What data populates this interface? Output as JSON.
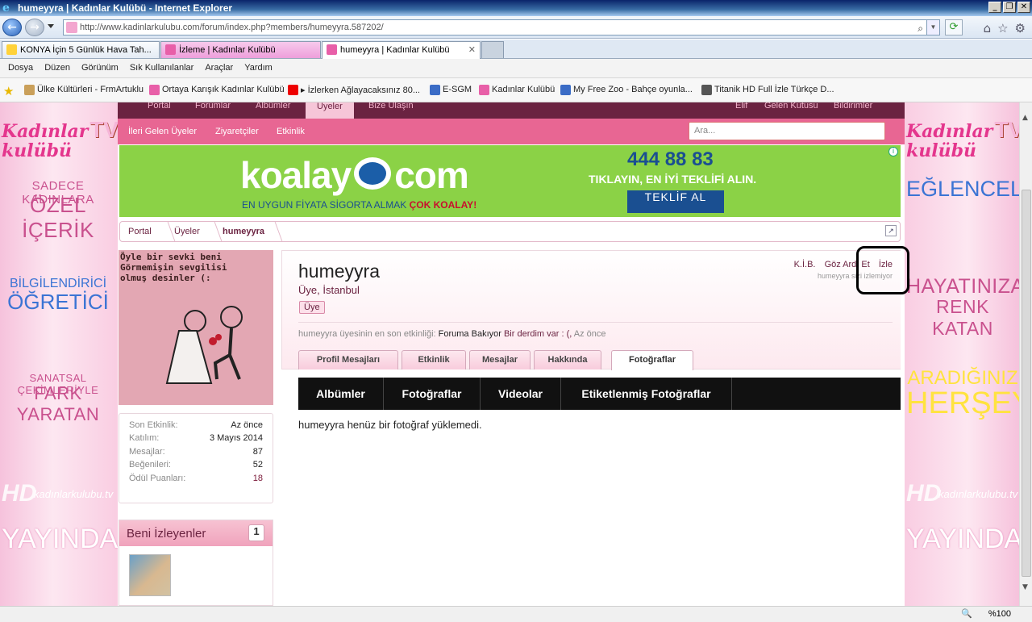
{
  "window": {
    "title": "humeyyra | Kadınlar Kulübü - Internet Explorer"
  },
  "address": {
    "url": "http://www.kadinlarkulubu.com/forum/index.php?members/humeyyra.587202/"
  },
  "tabs": [
    {
      "label": "KONYA İçin 5 Günlük Hava Tah..."
    },
    {
      "label": "İzleme | Kadınlar Kulübü"
    },
    {
      "label": "humeyyra | Kadınlar Kulübü"
    }
  ],
  "menu": [
    "Dosya",
    "Düzen",
    "Görünüm",
    "Sık Kullanılanlar",
    "Araçlar",
    "Yardım"
  ],
  "favorites": [
    "Ülke Kültürleri - FrmArtuklu",
    "Ortaya Karışık  Kadınlar Kulübü",
    "▸ İzlerken Ağlayacaksınız 80...",
    "E-SGM",
    "Kadınlar Kulübü",
    "My Free Zoo - Bahçe oyunla...",
    "Titanik HD Full İzle Türkçe D..."
  ],
  "left_ad": {
    "logo_line1": "Kadınlar",
    "logo_line2": "kulübü",
    "logo_tv": "TV",
    "l1": "SADECE KADINLARA",
    "l2": "ÖZEL İÇERİK",
    "l3": "BİLGİLENDİRİCİ",
    "l4": "ÖĞRETİCİ",
    "l5": "SANATSAL ÇEKİMLERİYLE",
    "l6": "FARK YARATAN",
    "hd": "HD",
    "site": "kadınlarkulubu.tv",
    "yayinda": "YAYINDA"
  },
  "right_ad": {
    "logo_line1": "Kadınlar",
    "logo_line2": "kulübü",
    "logo_tv": "TV",
    "l1": "EĞLENCELİ",
    "l2": "HAYATINIZA",
    "l3": "RENK KATAN",
    "l4": "ARADIĞINIZ",
    "l5": "HERŞEY",
    "hd": "HD",
    "site": "kadınlarkulubu.tv",
    "yayinda": "YAYINDA"
  },
  "site_nav": {
    "portal": "Portal",
    "forumlar": "Forumlar",
    "albumler": "Albümler",
    "uyeler": "Üyeler",
    "bize_ulasin": "Bize Ulaşın",
    "user": "Elif",
    "inbox": "Gelen Kutusu",
    "alerts": "Bildirimler"
  },
  "sub_nav": {
    "notable": "İleri Gelen Üyeler",
    "visitors": "Ziyaretçiler",
    "activity": "Etkinlik",
    "search_placeholder": "Ara..."
  },
  "banner": {
    "brand_left": "koalay",
    "brand_right": "com",
    "tagline": "EN UYGUN FİYATA SİGORTA ALMAK",
    "tagline_bold": "ÇOK KOALAY!",
    "phone": "444 88 83",
    "cta_text": "TIKLAYIN, EN İYİ TEKLİFİ ALIN.",
    "cta_button": "TEKLİF AL"
  },
  "breadcrumb": [
    "Portal",
    "Üyeler",
    "humeyyra"
  ],
  "avatar": {
    "caption": "Öyle bir sevki beni\nGörmemişin sevgilisi\nolmuş desinler (:"
  },
  "stats": [
    {
      "k": "Son Etkinlik:",
      "v": "Az önce"
    },
    {
      "k": "Katılım:",
      "v": "3 Mayıs 2014"
    },
    {
      "k": "Mesajlar:",
      "v": "87"
    },
    {
      "k": "Beğenileri:",
      "v": "52"
    },
    {
      "k": "Ödül Puanları:",
      "v": "18"
    }
  ],
  "followers": {
    "title": "Beni İzleyenler",
    "count": "1"
  },
  "profile": {
    "username": "humeyyra",
    "location": "Üye, İstanbul",
    "badge": "Üye",
    "actions": {
      "report": "K.İ.B.",
      "ignore": "Göz Ardı Et",
      "follow": "İzle"
    },
    "follow_note": "humeyyra sizi izlemiyor",
    "activity_prefix": "humeyyra üyesinin en son etkinliği:",
    "activity_action": "Foruma Bakıyor",
    "activity_link": "Bir derdim var : (,",
    "activity_time": "Az önce"
  },
  "profile_tabs": [
    "Profil Mesajları",
    "Etkinlik",
    "Mesajlar",
    "Hakkında",
    "Fotoğraflar"
  ],
  "photo_nav": [
    "Albümler",
    "Fotoğraflar",
    "Videolar",
    "Etiketlenmiş Fotoğraflar"
  ],
  "empty_message": "humeyyra henüz bir fotoğraf yüklemedi.",
  "status": {
    "zoom": "%100"
  }
}
